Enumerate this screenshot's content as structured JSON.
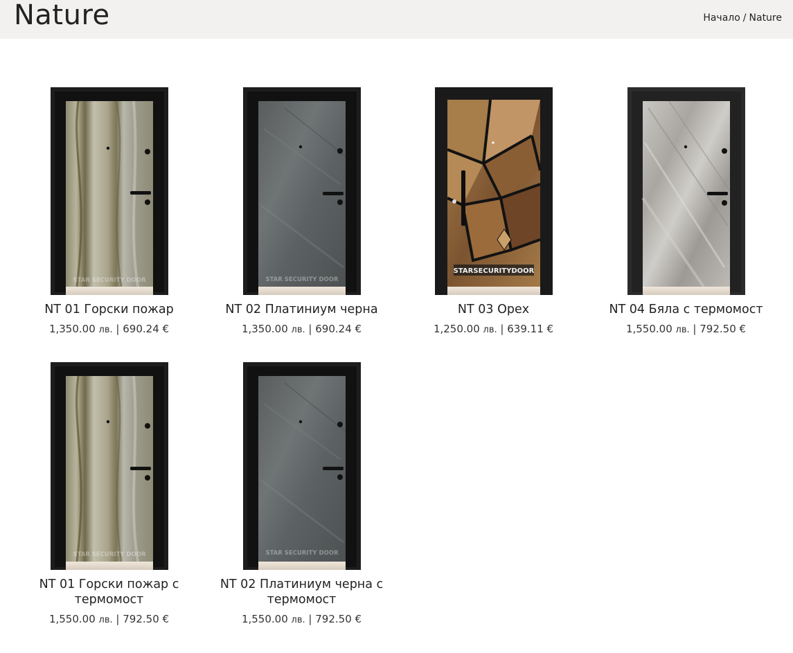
{
  "header": {
    "title": "Nature",
    "breadcrumb": {
      "home": "Начало",
      "separator": "/",
      "current": "Nature"
    }
  },
  "products": [
    {
      "name": "NT 01 Горски пожар",
      "price_bgn": "1,350.00",
      "currency_bgn": "лв.",
      "price_eur": "690.24 €",
      "finish": "wood-marble",
      "watermark": "STAR SECURITY DOOR"
    },
    {
      "name": "NT 02 Платиниум черна",
      "price_bgn": "1,350.00",
      "currency_bgn": "лв.",
      "price_eur": "690.24 €",
      "finish": "dark-slate",
      "watermark": "STAR SECURITY DOOR"
    },
    {
      "name": "NT 03 Орех",
      "price_bgn": "1,250.00",
      "currency_bgn": "лв.",
      "price_eur": "639.11 €",
      "finish": "walnut-mosaic",
      "watermark": "STARSECURITYDOOR"
    },
    {
      "name": "NT 04 Бяла с термомост",
      "price_bgn": "1,550.00",
      "currency_bgn": "лв.",
      "price_eur": "792.50 €",
      "finish": "light-marble",
      "watermark": ""
    },
    {
      "name": "NT 01 Горски пожар с термомост",
      "price_bgn": "1,550.00",
      "currency_bgn": "лв.",
      "price_eur": "792.50 €",
      "finish": "wood-marble",
      "watermark": "STAR SECURITY DOOR"
    },
    {
      "name": "NT 02 Платиниум черна с термомост",
      "price_bgn": "1,550.00",
      "currency_bgn": "лв.",
      "price_eur": "792.50 €",
      "finish": "dark-slate",
      "watermark": "STAR SECURITY DOOR"
    }
  ],
  "price_separator": "|"
}
